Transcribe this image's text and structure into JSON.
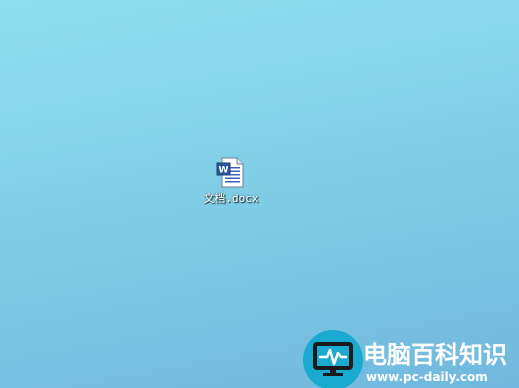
{
  "desktop": {
    "background_color": "#84d3e8",
    "items": [
      {
        "label": "文档.docx",
        "icon": "word-document-icon"
      }
    ]
  },
  "watermark": {
    "title": "电脑百科知识",
    "url": "www.pc-daily.com",
    "icon": "monitor-pulse-icon",
    "badge_color": "#1aa9cf"
  }
}
